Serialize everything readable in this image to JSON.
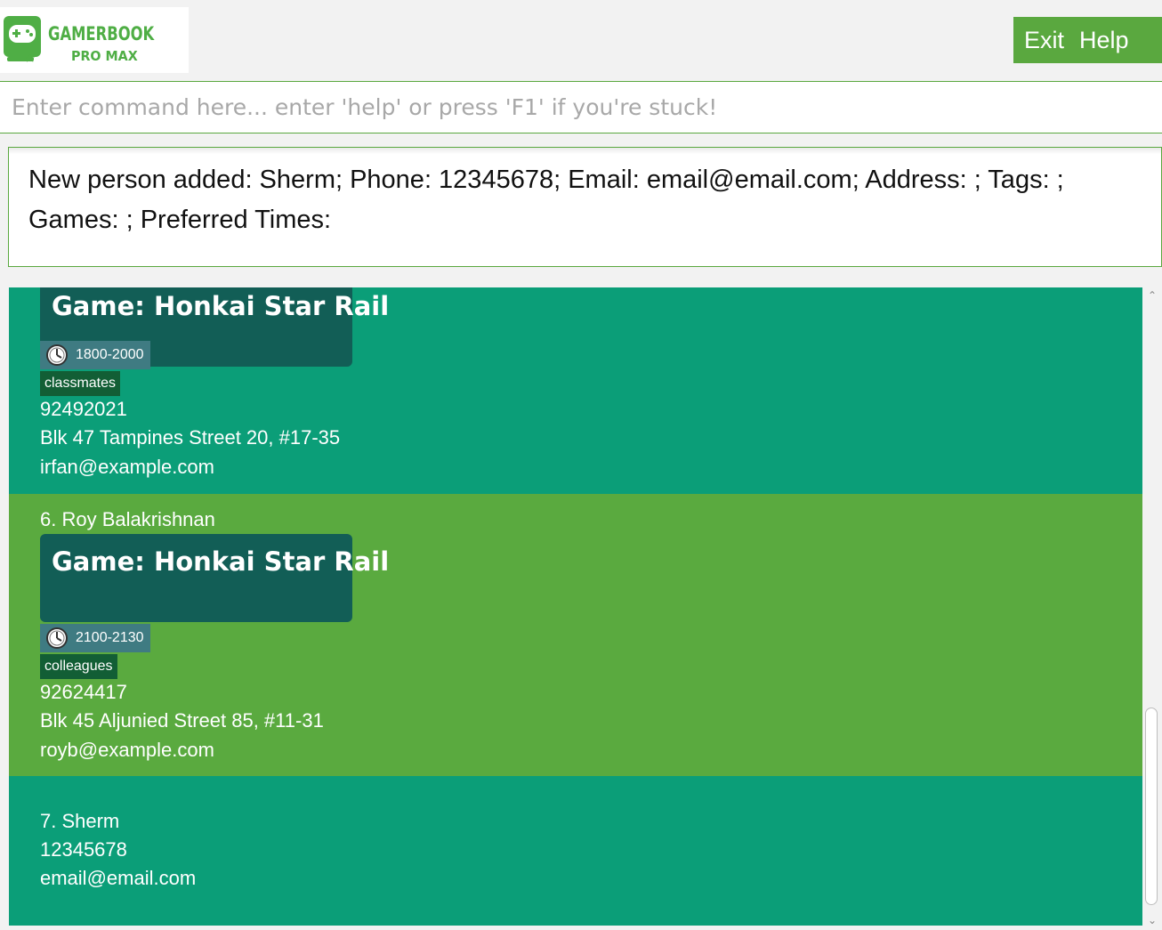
{
  "app": {
    "logo_title": "GAMERBOOK",
    "logo_subtitle": "PRO MAX",
    "menu": {
      "exit_label": "Exit",
      "help_label": "Help"
    }
  },
  "command": {
    "placeholder": "Enter command here... enter 'help' or press 'F1' if you're stuck!",
    "value": ""
  },
  "result": {
    "message": "New person added: Sherm; Phone: 12345678; Email: email@email.com; Address: ; Tags: ; Games: ; Preferred Times:"
  },
  "persons": [
    {
      "game": "Game: Honkai Star Rail",
      "time": "1800-2000",
      "tag": "classmates",
      "phone": "92492021",
      "address": "Blk 47 Tampines Street 20, #17-35",
      "email": "irfan@example.com"
    },
    {
      "name": "6. Roy Balakrishnan",
      "game": "Game: Honkai Star Rail",
      "time": "2100-2130",
      "tag": "colleagues",
      "phone": "92624417",
      "address": "Blk 45 Aljunied Street 85, #11-31",
      "email": "royb@example.com"
    },
    {
      "name": "7. Sherm",
      "phone": "12345678",
      "email": "email@email.com"
    }
  ],
  "colors": {
    "accent_green": "#5aa83f",
    "card_teal": "#0b9e78",
    "card_green": "#5aaa3f",
    "game_box": "#125e56",
    "time_tag": "#3f7b82",
    "tag": "#125e35"
  },
  "scroll": {
    "position_fraction": 0.95
  }
}
